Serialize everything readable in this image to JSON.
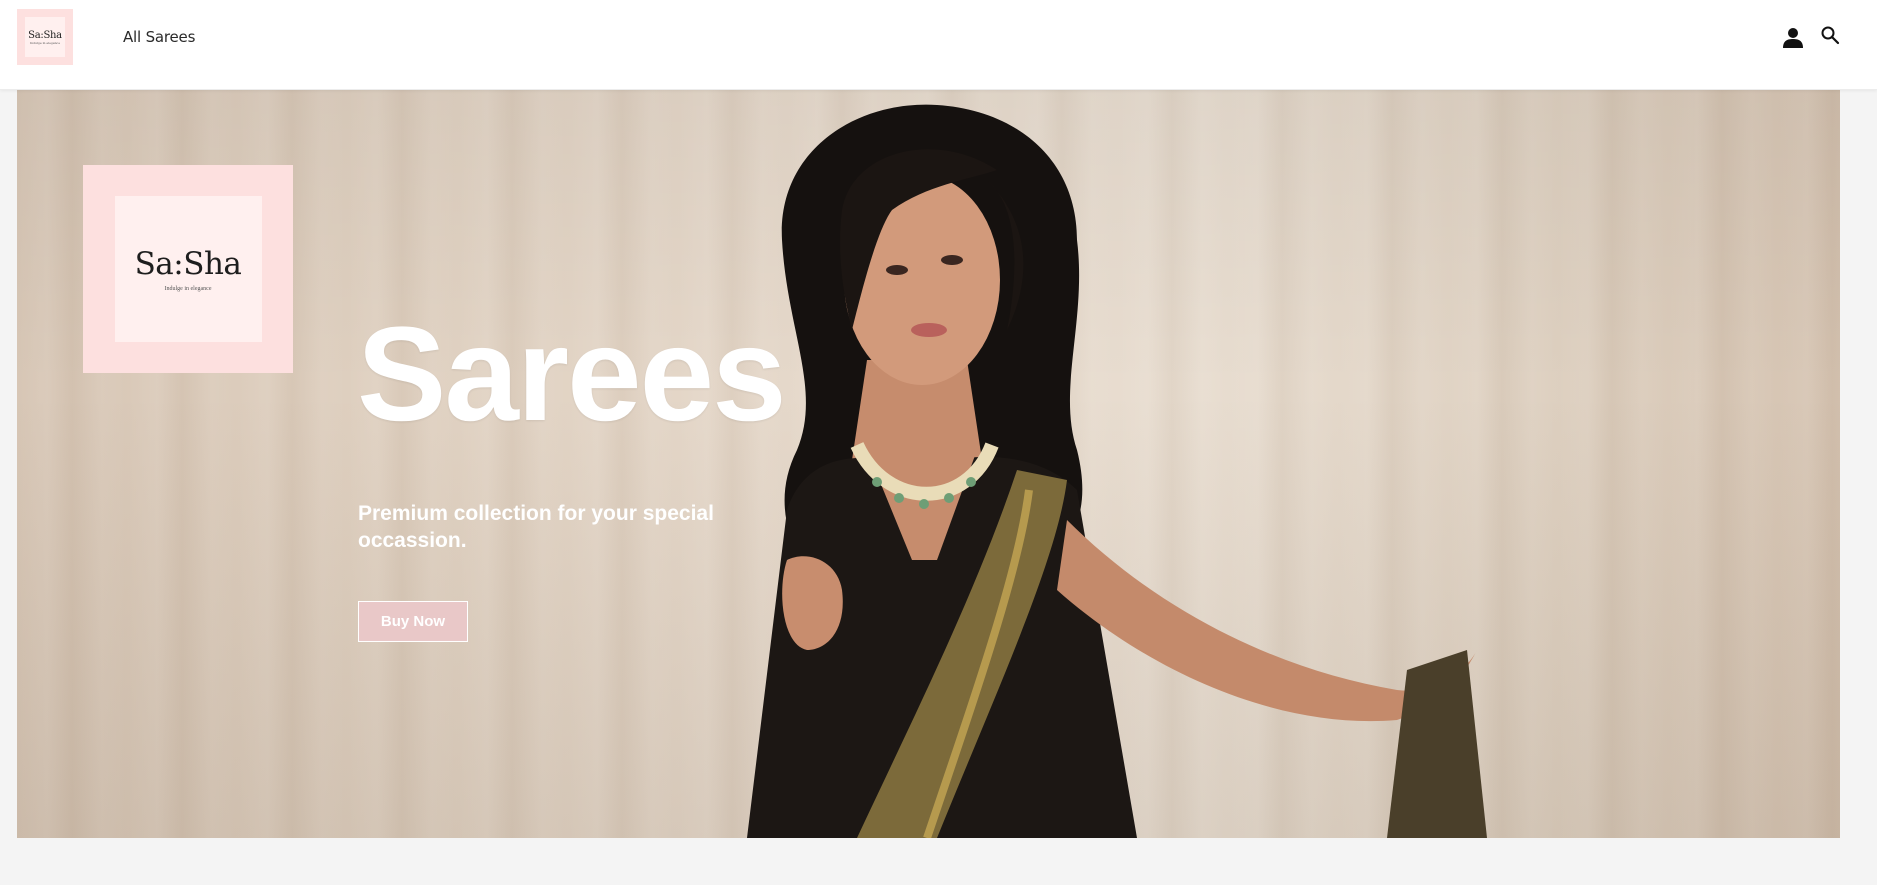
{
  "header": {
    "logo_text": "Sa:Sha",
    "logo_tagline": "Indulge in elegance",
    "nav": {
      "all_sarees": "All Sarees"
    },
    "icons": {
      "account": "user-icon",
      "search": "search-icon"
    }
  },
  "hero": {
    "logo_text": "Sa:Sha",
    "logo_tagline": "Indulge in elegance",
    "title": "Sarees",
    "subtitle": "Premium collection for your special occassion.",
    "cta_label": "Buy Now"
  },
  "colors": {
    "logo_bg": "#fde0df",
    "logo_inner": "#fff0ef",
    "button_bg": "#e9c8c8",
    "page_bg": "#f4f4f4"
  }
}
